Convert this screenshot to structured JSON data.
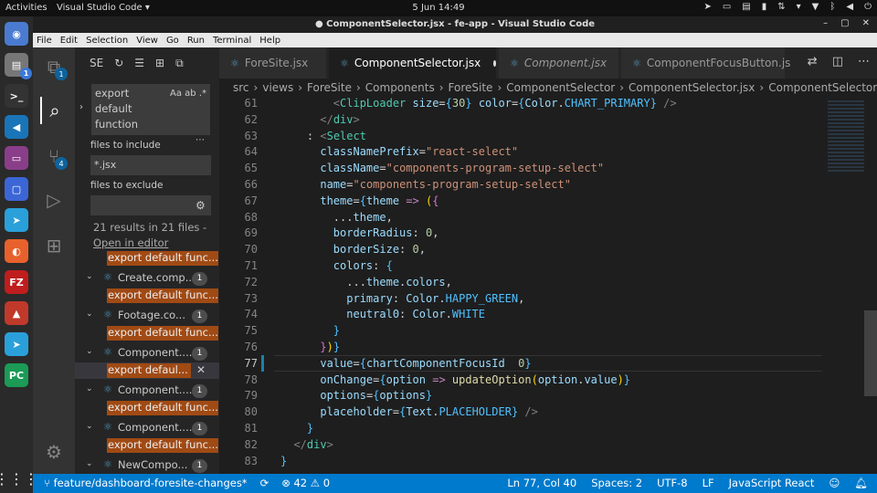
{
  "topbar": {
    "activities": "Activities",
    "app": "Visual Studio Code ▾",
    "clock": "5 Jun  14:49"
  },
  "window": {
    "title": "● ComponentSelector.jsx - fe-app - Visual Studio Code"
  },
  "menu": [
    "File",
    "Edit",
    "Selection",
    "View",
    "Go",
    "Run",
    "Terminal",
    "Help"
  ],
  "dock": [
    {
      "name": "chromium-icon",
      "glyph": "◉",
      "color": "#4a7bd1"
    },
    {
      "name": "files-icon",
      "glyph": "▤",
      "color": "#777"
    },
    {
      "name": "terminal-icon",
      "glyph": ">_",
      "color": "#333"
    },
    {
      "name": "vscode-icon",
      "glyph": "◀",
      "color": "#1a74b8"
    },
    {
      "name": "media-icon",
      "glyph": "▭",
      "color": "#8a3e8a"
    },
    {
      "name": "screenshot-icon",
      "glyph": "▢",
      "color": "#3c66d6"
    },
    {
      "name": "telegram-icon",
      "glyph": "➤",
      "color": "#2aa0da"
    },
    {
      "name": "firefox-icon",
      "glyph": "◐",
      "color": "#e8612c"
    },
    {
      "name": "filezilla-icon",
      "glyph": "FZ",
      "color": "#bf1e1e"
    },
    {
      "name": "redis-icon",
      "glyph": "▲",
      "color": "#c0392b"
    },
    {
      "name": "telegram2-icon",
      "glyph": "➤",
      "color": "#2aa0da"
    },
    {
      "name": "pycharm-icon",
      "glyph": "PC",
      "color": "#1b9b56"
    }
  ],
  "dock_badges": {
    "files": "1"
  },
  "activity_badges": {
    "explorer": "1",
    "scm": "4"
  },
  "search": {
    "header": "SE",
    "query": "export default function",
    "options": "Aa  ab  .*",
    "include_label": "files to include",
    "include_value": "*.jsx",
    "exclude_label": "files to exclude",
    "exclude_value": "",
    "summary": "21 results in 21 files -",
    "open_editor": "Open in editor"
  },
  "results": [
    {
      "kind": "match",
      "text": "export default func..."
    },
    {
      "kind": "file",
      "name": "Create.comp...",
      "count": "1"
    },
    {
      "kind": "match",
      "text": "export default func..."
    },
    {
      "kind": "file",
      "name": "Footage.co...",
      "count": "1"
    },
    {
      "kind": "match",
      "text": "export default func..."
    },
    {
      "kind": "file",
      "name": "Component....",
      "count": "1"
    },
    {
      "kind": "match",
      "text": "export defaul...",
      "selected": true
    },
    {
      "kind": "file",
      "name": "Component....",
      "count": "1"
    },
    {
      "kind": "match",
      "text": "export default func..."
    },
    {
      "kind": "file",
      "name": "Component....",
      "count": "1"
    },
    {
      "kind": "match",
      "text": "export default func..."
    },
    {
      "kind": "file",
      "name": "NewCompo...",
      "count": "1"
    }
  ],
  "tabs": [
    {
      "label": "ForeSite.jsx",
      "active": false,
      "italic": false
    },
    {
      "label": "ComponentSelector.jsx",
      "active": true,
      "italic": false,
      "dirty": true
    },
    {
      "label": "Component.jsx",
      "active": false,
      "italic": true
    },
    {
      "label": "ComponentFocusButton.js",
      "active": false,
      "italic": false
    }
  ],
  "breadcrumb": [
    "src",
    "›",
    "views",
    "›",
    "ForeSite",
    "›",
    "Components",
    "›",
    "ForeSite",
    "›",
    "ComponentSelector",
    "›",
    "ComponentSelector.jsx",
    "›",
    "ComponentSelector"
  ],
  "code_lines": [
    {
      "n": "61",
      "html": "        <span class=\"p\">&lt;</span><span class=\"t\">ClipLoader</span> <span class=\"a\">size</span>=<span class=\"c\">{</span><span class=\"n\">30</span><span class=\"c\">}</span> <span class=\"a\">color</span>=<span class=\"c\">{</span><span class=\"a\">Color</span>.<span class=\"c\">CHART_PRIMARY</span><span class=\"c\">}</span> <span class=\"p\">/&gt;</span>"
    },
    {
      "n": "62",
      "html": "      <span class=\"p\">&lt;/</span><span class=\"t\">div</span><span class=\"p\">&gt;</span>"
    },
    {
      "n": "63",
      "html": "    : <span class=\"p\">&lt;</span><span class=\"t\">Select</span>"
    },
    {
      "n": "64",
      "html": "      <span class=\"a\">classNamePrefix</span>=<span class=\"s\">\"react-select\"</span>"
    },
    {
      "n": "65",
      "html": "      <span class=\"a\">className</span>=<span class=\"s\">\"components-program-setup-select\"</span>"
    },
    {
      "n": "66",
      "html": "      <span class=\"a\">name</span>=<span class=\"s\">\"components-program-setup-select\"</span>"
    },
    {
      "n": "67",
      "html": "      <span class=\"a\">theme</span>=<span class=\"c\">{</span><span class=\"a\">theme</span> <span class=\"k\">=&gt;</span> <span class=\"b\">(</span><span class=\"br\">{</span>"
    },
    {
      "n": "68",
      "html": "        ...<span class=\"a\">theme</span>,"
    },
    {
      "n": "69",
      "html": "        <span class=\"a\">borderRadius</span>: <span class=\"n\">0</span>,"
    },
    {
      "n": "70",
      "html": "        <span class=\"a\">borderSize</span>: <span class=\"n\">0</span>,"
    },
    {
      "n": "71",
      "html": "        <span class=\"a\">colors</span>: <span class=\"c\">{</span>"
    },
    {
      "n": "72",
      "html": "          ...<span class=\"a\">theme</span>.<span class=\"a\">colors</span>,"
    },
    {
      "n": "73",
      "html": "          <span class=\"a\">primary</span>: <span class=\"a\">Color</span>.<span class=\"c\">HAPPY_GREEN</span>,"
    },
    {
      "n": "74",
      "html": "          <span class=\"a\">neutral0</span>: <span class=\"a\">Color</span>.<span class=\"c\">WHITE</span>"
    },
    {
      "n": "75",
      "html": "        <span class=\"c\">}</span>"
    },
    {
      "n": "76",
      "html": "      <span class=\"br\">}</span><span class=\"b\">)</span><span class=\"c\">}</span>"
    },
    {
      "n": "77",
      "html": "      <span class=\"a\">value</span>=<span class=\"c\">{</span><span class=\"a\">chartComponentFocusId</span>  <span class=\"n\">0</span><span class=\"c\">}</span>"
    },
    {
      "n": "78",
      "html": "      <span class=\"a\">onChange</span>=<span class=\"c\">{</span><span class=\"a\">option</span> <span class=\"k\">=&gt;</span> <span class=\"f\">updateOption</span><span class=\"b\">(</span><span class=\"a\">option</span>.<span class=\"a\">value</span><span class=\"b\">)</span><span class=\"c\">}</span>"
    },
    {
      "n": "79",
      "html": "      <span class=\"a\">options</span>=<span class=\"c\">{</span><span class=\"a\">options</span><span class=\"c\">}</span>"
    },
    {
      "n": "80",
      "html": "      <span class=\"a\">placeholder</span>=<span class=\"c\">{</span><span class=\"a\">Text</span>.<span class=\"c\">PLACEHOLDER</span><span class=\"c\">}</span> <span class=\"p\">/&gt;</span>"
    },
    {
      "n": "81",
      "html": "    <span class=\"c\">}</span>"
    },
    {
      "n": "82",
      "html": "  <span class=\"p\">&lt;/</span><span class=\"t\">div</span><span class=\"p\">&gt;</span>"
    },
    {
      "n": "83",
      "html": "<span class=\"c\">}</span>"
    }
  ],
  "status": {
    "branch": "feature/dashboard-foresite-changes*",
    "sync": "⟳",
    "problems": "⊗ 42 ⚠ 0",
    "position": "Ln 77, Col 40",
    "spaces": "Spaces: 2",
    "encoding": "UTF-8",
    "eol": "LF",
    "language": "JavaScript React"
  }
}
